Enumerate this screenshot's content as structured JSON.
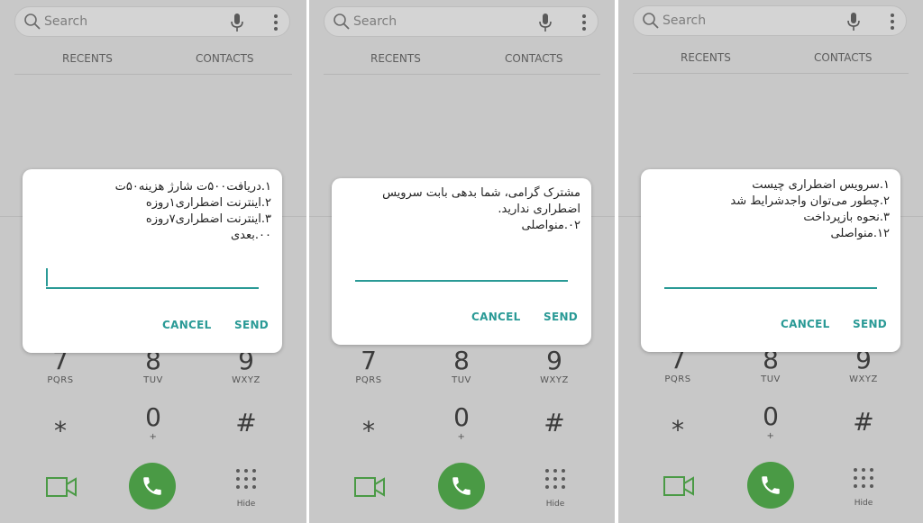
{
  "colors": {
    "accent": "#2a9a96",
    "call_green": "#4a9a45"
  },
  "search_placeholder": "Search",
  "tabs": {
    "recents": "RECENTS",
    "contacts": "CONTACTS"
  },
  "keypad": {
    "row1": [
      {
        "digit": "7",
        "letters": "PQRS"
      },
      {
        "digit": "8",
        "letters": "TUV"
      },
      {
        "digit": "9",
        "letters": "WXYZ"
      }
    ],
    "row2": [
      {
        "digit": "⁎",
        "letters": ""
      },
      {
        "digit": "0",
        "letters": "+"
      },
      {
        "digit": "#",
        "letters": ""
      }
    ]
  },
  "hide_label": "Hide",
  "dialogs": [
    {
      "lines": [
        "۱.دریافت۵۰۰ت شارژ هزینه۵۰ت",
        "۲.اینترنت اضطراری۱روزه",
        "۳.اینترنت اضطراری۷روزه",
        "۰۰.بعدی"
      ],
      "cancel": "CANCEL",
      "send": "SEND"
    },
    {
      "lines": [
        "مشترک گرامی، شما بدهی بابت سرویس",
        "اضطراری ندارید.",
        "۰۲.منواصلی"
      ],
      "cancel": "CANCEL",
      "send": "SEND"
    },
    {
      "lines": [
        "۱.سرویس اضطراری چیست",
        "۲.چطور می‌توان واجدشرایط شد",
        "۳.نحوه بازپرداخت",
        "۱۲.منواصلی"
      ],
      "cancel": "CANCEL",
      "send": "SEND"
    }
  ]
}
